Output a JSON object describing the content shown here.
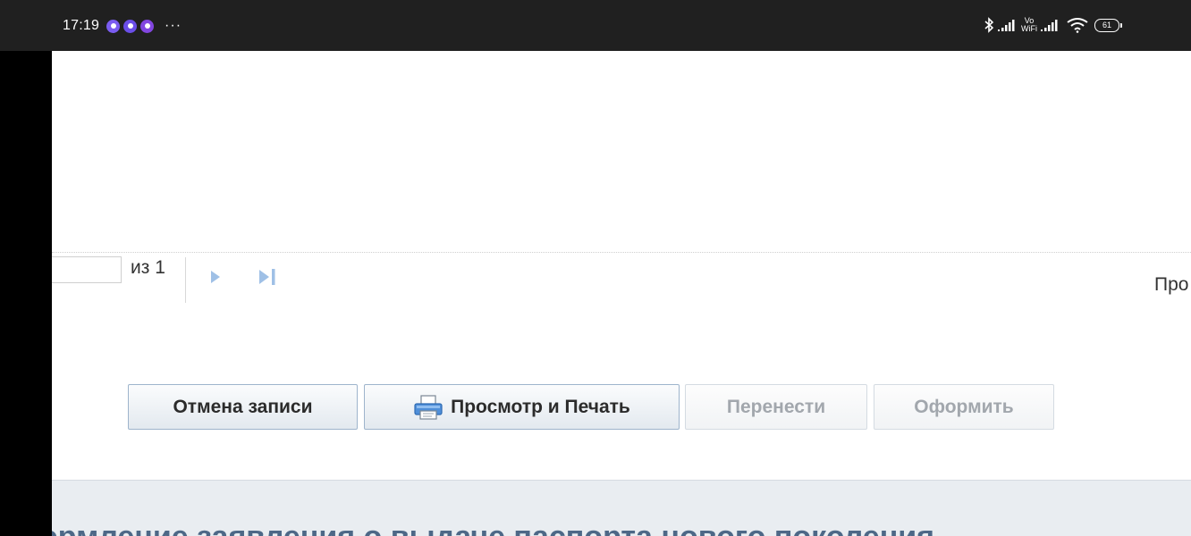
{
  "status_bar": {
    "time": "17:19",
    "more": "···",
    "app_icons": [
      "messenger-icon",
      "messenger-icon",
      "notification-icon"
    ],
    "vowifi_top": "Vo",
    "vowifi_bottom": "WiFi",
    "battery": "61"
  },
  "pager": {
    "current_page": "",
    "of_label": "из 1",
    "right_label": "Про"
  },
  "actions": {
    "cancel": "Отмена записи",
    "print": "Просмотр и Печать",
    "move": "Перенести",
    "form": "Оформить"
  },
  "section": {
    "heading": "ормление заявления о выдаче паспорта нового поколения"
  },
  "colors": {
    "status_bar": "#202020",
    "button_border": "#9eb4cc",
    "heading": "#4d6887",
    "panel": "#e9edf1"
  }
}
